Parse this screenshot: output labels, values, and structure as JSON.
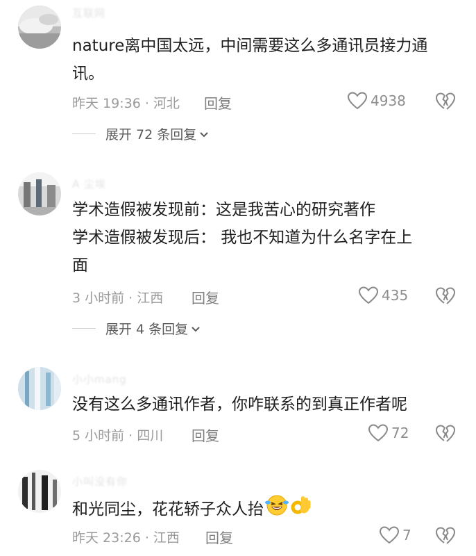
{
  "comments": [
    {
      "username": "互联网",
      "lines": [
        "nature离中国太远，中间需要这么多通讯员接力通",
        "讯。"
      ],
      "meta": "昨天 19:36 · 河北",
      "reply_label": "回复",
      "likes": "4938",
      "expand_label": "展开 72 条回复"
    },
    {
      "username": "A 尘埃",
      "lines": [
        "学术造假被发现前：这是我苦心的研究著作",
        "学术造假被发现后：  我也不知道为什么名字在上",
        "面"
      ],
      "meta": "3 小时前 · 江西",
      "reply_label": "回复",
      "likes": "435",
      "expand_label": "展开 4 条回复"
    },
    {
      "username": "小小mang",
      "lines": [
        "没有这么多通讯作者，你咋联系的到真正作者呢"
      ],
      "meta": "5 小时前 · 四川",
      "reply_label": "回复",
      "likes": "72"
    },
    {
      "username": "小叫没有你",
      "lines": [
        "和光同尘，花花轿子众人抬"
      ],
      "emojis": [
        "laughing-crying-emoji",
        "ok-hand-emoji"
      ],
      "meta": "昨天 23:26 · 江西",
      "reply_label": "回复",
      "likes": "7"
    }
  ],
  "icons": {
    "like": "heart-outline-icon",
    "dislike": "broken-heart-icon",
    "expand": "chevron-down-icon"
  }
}
